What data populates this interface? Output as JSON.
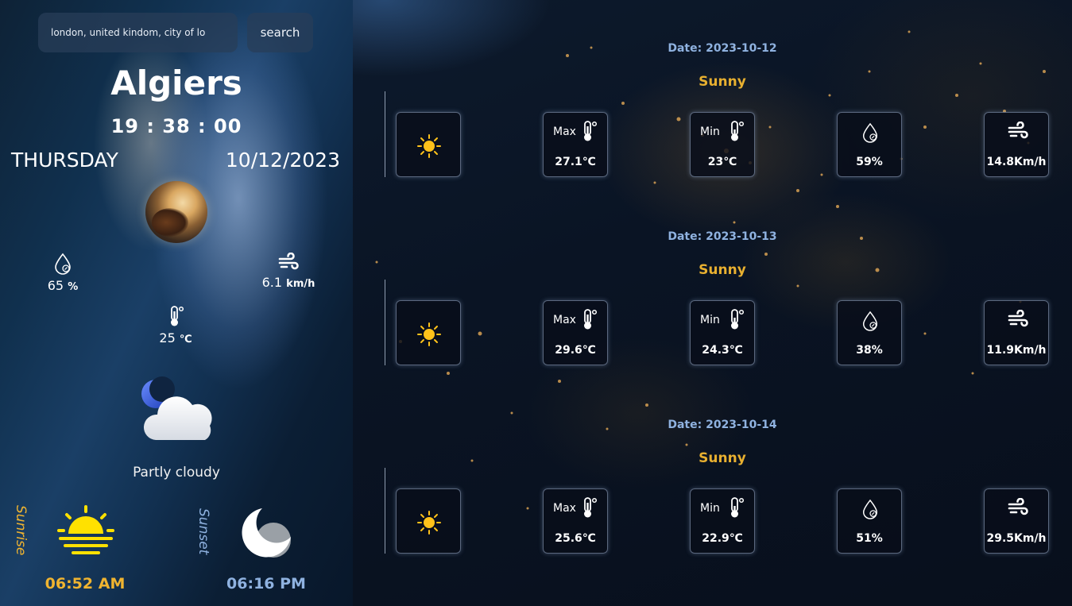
{
  "search": {
    "value": "london, united kindom, city of lo",
    "button_label": "search"
  },
  "current": {
    "city": "Algiers",
    "clock": "19 : 38 : 00",
    "day": "THURSDAY",
    "date": "10/12/2023",
    "humidity_value": "65",
    "humidity_unit": "%",
    "wind_value": "6.1",
    "wind_unit": "km/h",
    "temp_value": "25",
    "temp_unit": "℃",
    "condition": "Partly cloudy",
    "condition_icon": "partly-cloudy-night-icon"
  },
  "sun": {
    "sunrise_label": "Sunrise",
    "sunrise_time": "06:52 AM",
    "sunset_label": "Sunset",
    "sunset_time": "06:16 PM"
  },
  "forecast": [
    {
      "date_label": "Date: 2023-10-12",
      "condition": "Sunny",
      "max_label": "Max",
      "max": "27.1℃",
      "min_label": "Min",
      "min": "23℃",
      "humidity": "59%",
      "wind": "14.8Km/h"
    },
    {
      "date_label": "Date: 2023-10-13",
      "condition": "Sunny",
      "max_label": "Max",
      "max": "29.6℃",
      "min_label": "Min",
      "min": "24.3℃",
      "humidity": "38%",
      "wind": "11.9Km/h"
    },
    {
      "date_label": "Date: 2023-10-14",
      "condition": "Sunny",
      "max_label": "Max",
      "max": "25.6℃",
      "min_label": "Min",
      "min": "22.9℃",
      "humidity": "51%",
      "wind": "29.5Km/h"
    }
  ],
  "colors": {
    "accent_gold": "#f0b430",
    "accent_blue": "#8fb2e0",
    "sunny_text": "#e8b030"
  }
}
